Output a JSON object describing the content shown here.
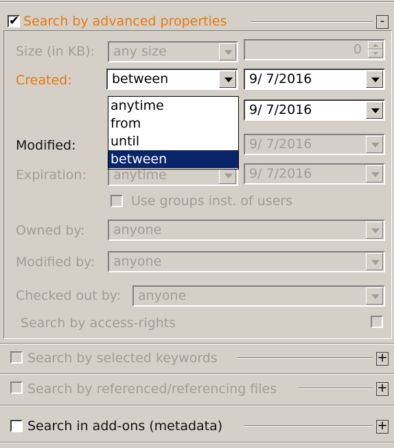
{
  "advanced": {
    "title": "Search by advanced properties",
    "checked": true,
    "collapse_btn": "-",
    "size_label": "Size (in KB):",
    "size_value": "any size",
    "size_number": "0",
    "created_label": "Created:",
    "created_mode": "between",
    "created_from": "9/ 7/2016",
    "created_to": "9/ 7/2016",
    "dropdown_options": [
      "anytime",
      "from",
      "until",
      "between"
    ],
    "dropdown_selected": "between",
    "modified_label": "Modified:",
    "modified_date": "9/ 7/2016",
    "expiration_label": "Expiration:",
    "expiration_value": "anytime",
    "expiration_date": "9/ 7/2016",
    "use_groups_label": "Use groups inst. of users",
    "owned_by_label": "Owned by:",
    "owned_by_value": "anyone",
    "modified_by_label": "Modified by:",
    "modified_by_value": "anyone",
    "checked_out_label": "Checked out by:",
    "checked_out_value": "anyone",
    "access_rights_label": "Search by access-rights"
  },
  "sections": [
    {
      "title": "Search by selected keywords",
      "expand_btn": "+",
      "enabled": false
    },
    {
      "title": "Search by referenced/referencing files",
      "expand_btn": "+",
      "enabled": false
    },
    {
      "title": "Search in add-ons (metadata)",
      "expand_btn": "+",
      "enabled": true
    }
  ],
  "colors": {
    "accent": "#e8780e",
    "selection": "#0a246a",
    "disabled_text": "#a09d96",
    "panel": "#d4d0c8"
  }
}
